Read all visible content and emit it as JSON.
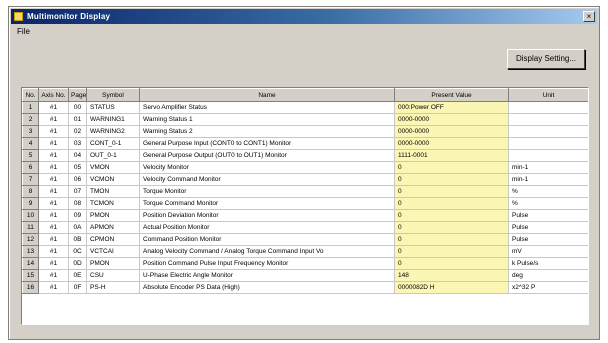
{
  "window": {
    "title": "Multimonitor Display",
    "close_glyph": "×"
  },
  "menu": {
    "file_label": "File"
  },
  "toolbar": {
    "display_setting_label": "Display Setting..."
  },
  "table": {
    "headers": {
      "no": "No.",
      "axis": "Axis No.",
      "page": "Page",
      "symbol": "Symbol",
      "name": "Name",
      "value": "Present Value",
      "unit": "Unit"
    },
    "rows": [
      {
        "no": "1",
        "axis": "#1",
        "page": "00",
        "symbol": "STATUS",
        "name": "Servo Amplifier Status",
        "value": "000:Power OFF",
        "unit": ""
      },
      {
        "no": "2",
        "axis": "#1",
        "page": "01",
        "symbol": "WARNING1",
        "name": "Warning Status 1",
        "value": "0000-0000",
        "unit": ""
      },
      {
        "no": "3",
        "axis": "#1",
        "page": "02",
        "symbol": "WARNING2",
        "name": "Warning Status 2",
        "value": "0000-0000",
        "unit": ""
      },
      {
        "no": "4",
        "axis": "#1",
        "page": "03",
        "symbol": "CONT_0-1",
        "name": "General Purpose Input (CONT0 to CONT1) Monitor",
        "value": "0000-0000",
        "unit": ""
      },
      {
        "no": "5",
        "axis": "#1",
        "page": "04",
        "symbol": "OUT_0-1",
        "name": "General Purpose Output (OUT0 to OUT1) Monitor",
        "value": "1111-0001",
        "unit": ""
      },
      {
        "no": "6",
        "axis": "#1",
        "page": "05",
        "symbol": "VMON",
        "name": "Velocity Monitor",
        "value": "0",
        "unit": "min-1"
      },
      {
        "no": "7",
        "axis": "#1",
        "page": "06",
        "symbol": "VCMON",
        "name": "Velocity Command Monitor",
        "value": "0",
        "unit": "min-1"
      },
      {
        "no": "8",
        "axis": "#1",
        "page": "07",
        "symbol": "TMON",
        "name": "Torque Monitor",
        "value": "0",
        "unit": "%"
      },
      {
        "no": "9",
        "axis": "#1",
        "page": "08",
        "symbol": "TCMON",
        "name": "Torque Command Monitor",
        "value": "0",
        "unit": "%"
      },
      {
        "no": "10",
        "axis": "#1",
        "page": "09",
        "symbol": "PMON",
        "name": "Position Deviation Monitor",
        "value": "0",
        "unit": "Pulse"
      },
      {
        "no": "11",
        "axis": "#1",
        "page": "0A",
        "symbol": "APMON",
        "name": "Actual Position Monitor",
        "value": "0",
        "unit": "Pulse"
      },
      {
        "no": "12",
        "axis": "#1",
        "page": "0B",
        "symbol": "CPMON",
        "name": "Command Position Monitor",
        "value": "0",
        "unit": "Pulse"
      },
      {
        "no": "13",
        "axis": "#1",
        "page": "0C",
        "symbol": "VCTCAI",
        "name": "Analog Velocity Command / Analog Torque Command Input Vo",
        "value": "0",
        "unit": "mV"
      },
      {
        "no": "14",
        "axis": "#1",
        "page": "0D",
        "symbol": "PMON",
        "name": "Position Command Pulse Input Frequency Monitor",
        "value": "0",
        "unit": "k Pulse/s"
      },
      {
        "no": "15",
        "axis": "#1",
        "page": "0E",
        "symbol": "CSU",
        "name": "U-Phase Electric Angle Monitor",
        "value": "148",
        "unit": "deg"
      },
      {
        "no": "16",
        "axis": "#1",
        "page": "0F",
        "symbol": "PS-H",
        "name": "Absolute Encoder PS Data (High)",
        "value": "0000082D H",
        "unit": "x2^32 P"
      }
    ]
  }
}
